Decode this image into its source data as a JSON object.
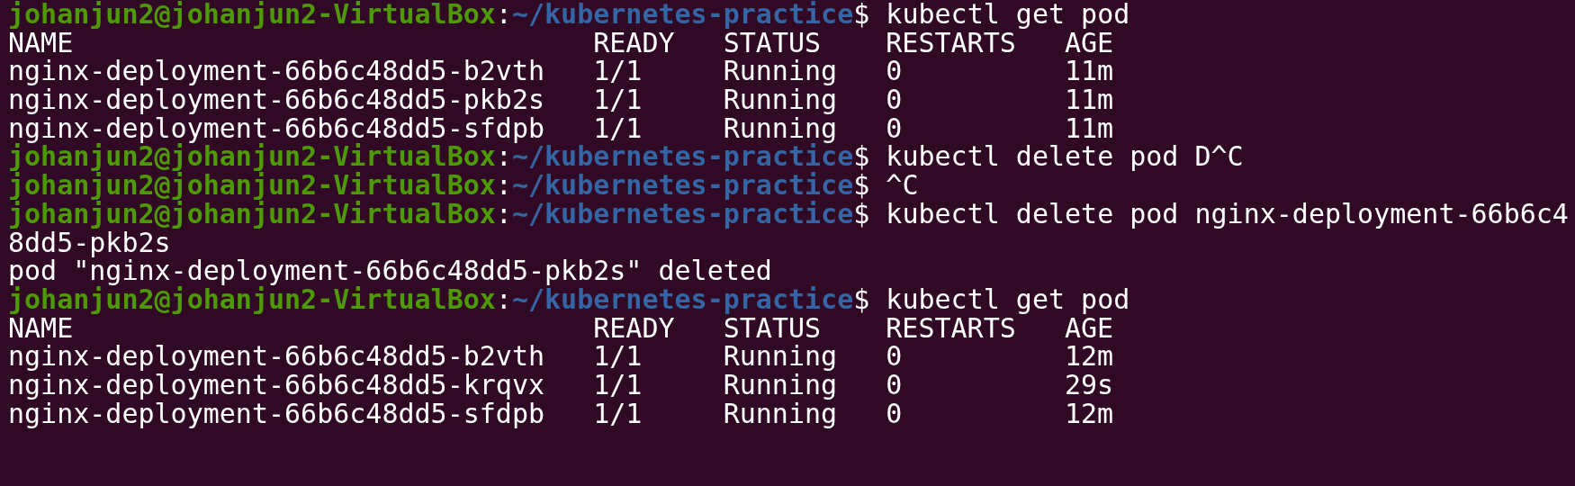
{
  "terminal": {
    "lines": [
      {
        "kind": "prompt",
        "user_host": "johanjun2@johanjun2-VirtualBox",
        "separator": ":",
        "path": "~/kubernetes-practice",
        "symbol": "$",
        "command": "kubectl get pod"
      },
      {
        "kind": "table",
        "cells": [
          "NAME",
          "READY",
          "STATUS",
          "RESTARTS",
          "AGE"
        ]
      },
      {
        "kind": "table",
        "cells": [
          "nginx-deployment-66b6c48dd5-b2vth",
          "1/1",
          "Running",
          "0",
          "11m"
        ]
      },
      {
        "kind": "table",
        "cells": [
          "nginx-deployment-66b6c48dd5-pkb2s",
          "1/1",
          "Running",
          "0",
          "11m"
        ]
      },
      {
        "kind": "table",
        "cells": [
          "nginx-deployment-66b6c48dd5-sfdpb",
          "1/1",
          "Running",
          "0",
          "11m"
        ]
      },
      {
        "kind": "prompt",
        "user_host": "johanjun2@johanjun2-VirtualBox",
        "separator": ":",
        "path": "~/kubernetes-practice",
        "symbol": "$",
        "command": "kubectl delete pod D^C"
      },
      {
        "kind": "prompt",
        "user_host": "johanjun2@johanjun2-VirtualBox",
        "separator": ":",
        "path": "~/kubernetes-practice",
        "symbol": "$",
        "command": "^C"
      },
      {
        "kind": "prompt",
        "user_host": "johanjun2@johanjun2-VirtualBox",
        "separator": ":",
        "path": "~/kubernetes-practice",
        "symbol": "$",
        "command": "kubectl delete pod nginx-deployment-66b6c4"
      },
      {
        "kind": "output",
        "text": "8dd5-pkb2s"
      },
      {
        "kind": "output",
        "text": "pod \"nginx-deployment-66b6c48dd5-pkb2s\" deleted"
      },
      {
        "kind": "prompt",
        "user_host": "johanjun2@johanjun2-VirtualBox",
        "separator": ":",
        "path": "~/kubernetes-practice",
        "symbol": "$",
        "command": "kubectl get pod"
      },
      {
        "kind": "table",
        "cells": [
          "NAME",
          "READY",
          "STATUS",
          "RESTARTS",
          "AGE"
        ]
      },
      {
        "kind": "table",
        "cells": [
          "nginx-deployment-66b6c48dd5-b2vth",
          "1/1",
          "Running",
          "0",
          "12m"
        ]
      },
      {
        "kind": "table",
        "cells": [
          "nginx-deployment-66b6c48dd5-krqvx",
          "1/1",
          "Running",
          "0",
          "29s"
        ]
      },
      {
        "kind": "table",
        "cells": [
          "nginx-deployment-66b6c48dd5-sfdpb",
          "1/1",
          "Running",
          "0",
          "12m"
        ]
      }
    ]
  }
}
